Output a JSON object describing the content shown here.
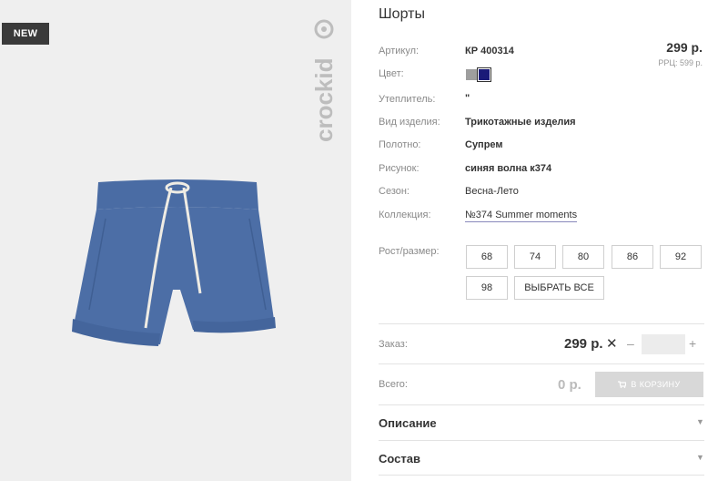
{
  "badge": "NEW",
  "brand": "crockid",
  "product": {
    "title": "Шорты",
    "price": "299 р.",
    "rrp": "РРЦ: 599 р."
  },
  "attributes": [
    {
      "label": "Артикул:",
      "value": "КР 400314"
    },
    {
      "label": "Цвет:",
      "value": ""
    },
    {
      "label": "Утеплитель:",
      "value": "\""
    },
    {
      "label": "Вид изделия:",
      "value": "Трикотажные изделия"
    },
    {
      "label": "Полотно:",
      "value": "Супрем"
    },
    {
      "label": "Рисунок:",
      "value": "синяя волна к374"
    },
    {
      "label": "Сезон:",
      "value": "Весна-Лето"
    },
    {
      "label": "Коллекция:",
      "value": "№374 Summer moments"
    }
  ],
  "colors": {
    "swatch_1": "#9e9e9e",
    "swatch_2": "#1a1a78",
    "shorts": "#4c6ea6",
    "drawstring": "#efece4"
  },
  "sizes": {
    "label": "Рост/размер:",
    "options": [
      "68",
      "74",
      "80",
      "86",
      "92",
      "98"
    ],
    "select_all": "ВЫБРАТЬ ВСЕ"
  },
  "order": {
    "label": "Заказ:",
    "price": "299 р.",
    "times": "✕",
    "minus": "–",
    "plus": "+",
    "quantity": ""
  },
  "total": {
    "label": "Всего:",
    "value": "0 р.",
    "cart_button": "В КОРЗИНУ"
  },
  "sections": [
    {
      "title": "Описание",
      "icon": "chevron-down-icon"
    },
    {
      "title": "Состав",
      "icon": "chevron-down-icon"
    }
  ]
}
